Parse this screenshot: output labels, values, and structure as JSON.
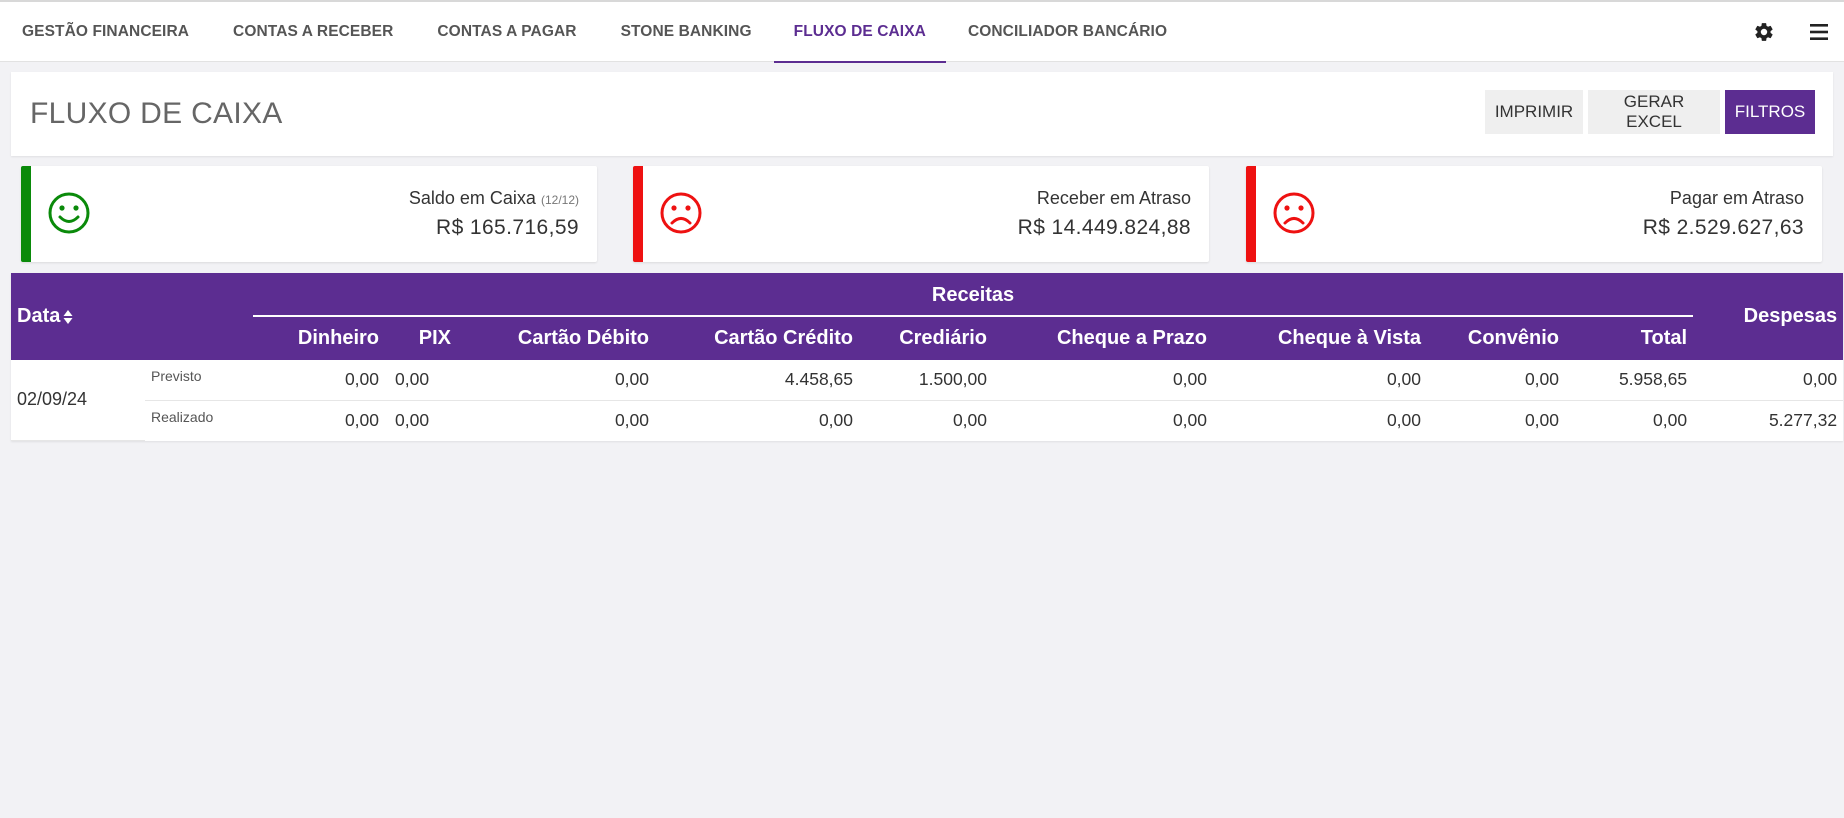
{
  "nav": {
    "tabs": [
      {
        "label": "GESTÃO FINANCEIRA"
      },
      {
        "label": "CONTAS A RECEBER"
      },
      {
        "label": "CONTAS A PAGAR"
      },
      {
        "label": "STONE BANKING"
      },
      {
        "label": "FLUXO DE CAIXA",
        "active": true
      },
      {
        "label": "CONCILIADOR BANCÁRIO"
      }
    ],
    "icons": [
      "gear-icon",
      "hamburger-menu-icon"
    ]
  },
  "page": {
    "title": "FLUXO DE CAIXA",
    "actions": {
      "print": "IMPRIMIR",
      "excel": "GERAR EXCEL",
      "filters": "FILTROS"
    }
  },
  "cards": [
    {
      "label": "Saldo em Caixa",
      "note": "(12/12)",
      "value": "R$ 165.716,59",
      "status": "happy",
      "color": "#0a8a0a"
    },
    {
      "label": "Receber em Atraso",
      "value": "R$ 14.449.824,88",
      "status": "sad",
      "color": "#ee1111"
    },
    {
      "label": "Pagar em Atraso",
      "value": "R$ 2.529.627,63",
      "status": "sad",
      "color": "#ee1111"
    }
  ],
  "table": {
    "headers": {
      "data": "Data",
      "receitas": "Receitas",
      "despesas": "Despesas",
      "columns": [
        "Dinheiro",
        "PIX",
        "Cartão Débito",
        "Cartão Crédito",
        "Crediário",
        "Cheque a Prazo",
        "Cheque à Vista",
        "Convênio",
        "Total"
      ]
    },
    "rows": [
      {
        "date": "02/09/24",
        "previsto": {
          "label": "Previsto",
          "values": [
            "0,00",
            "0,00",
            "0,00",
            "4.458,65",
            "1.500,00",
            "0,00",
            "0,00",
            "0,00",
            "5.958,65"
          ],
          "despesas": "0,00"
        },
        "realizado": {
          "label": "Realizado",
          "values": [
            "0,00",
            "0,00",
            "0,00",
            "0,00",
            "0,00",
            "0,00",
            "0,00",
            "0,00",
            "0,00"
          ],
          "despesas": "5.277,32"
        }
      }
    ]
  },
  "colors": {
    "brand": "#5c2d91",
    "positive": "#0a8a0a",
    "negative": "#ee1111"
  }
}
